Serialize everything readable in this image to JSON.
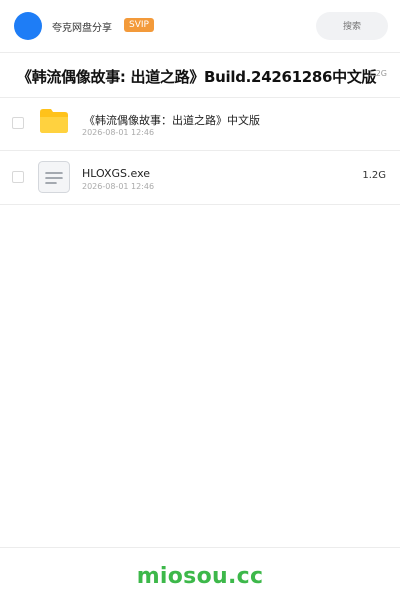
{
  "header": {
    "user_name": "夸克网盘分享",
    "badge": "SVIP",
    "search_placeholder": "搜索",
    "accent_color": "#1e7df6",
    "badge_color": "#f39a3a"
  },
  "share": {
    "title": "《韩流偶像故事: 出道之路》Build.24261286中文版",
    "total_size": "1.2G"
  },
  "files": [
    {
      "icon": "folder-icon",
      "name": "《韩流偶像故事：出道之路》中文版",
      "date": "2026-08-01 12:46",
      "size": ""
    },
    {
      "icon": "file-icon",
      "name": "HLOXGS.exe",
      "date": "2026-08-01 12:46",
      "size": "1.2G"
    }
  ],
  "footer": {
    "watermark": "miosou.cc",
    "watermark_color": "#3db84a"
  }
}
